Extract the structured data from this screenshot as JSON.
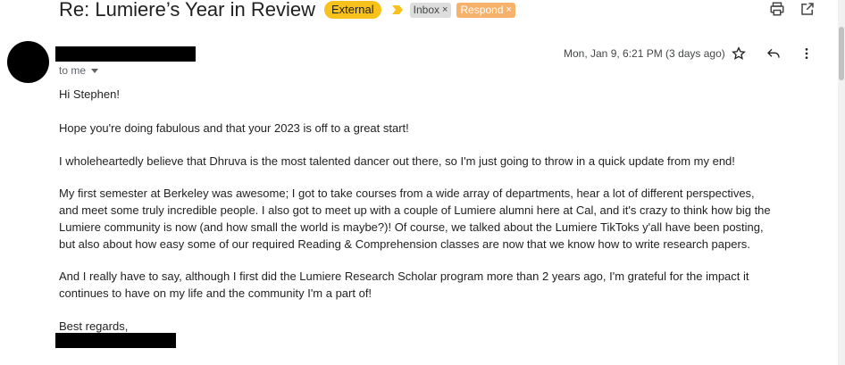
{
  "header": {
    "subject": "Re: Lumiere’s Year in Review",
    "labels": {
      "external": "External",
      "inbox": "Inbox",
      "respond": "Respond",
      "remove_glyph": "×"
    },
    "icons": [
      "print-icon",
      "open-in-new-window-icon"
    ]
  },
  "message": {
    "recipient_line": "to me",
    "date": "Mon, Jan 9, 6:21 PM (3 days ago)",
    "action_icons": [
      "star-icon",
      "reply-icon",
      "more-vert-icon"
    ],
    "body": [
      "Hi Stephen!",
      "Hope you're doing fabulous and that your 2023 is off to a great start!",
      "I wholeheartedly believe that Dhruva is the most talented dancer out there, so I'm just going to throw in a quick update from my end!",
      "My first semester at Berkeley was awesome; I got to take courses from a wide array of departments, hear a lot of different perspectives, and meet some truly incredible people. I also got to meet up with a couple of Lumiere alumni here at Cal, and it's crazy to think how big the Lumiere community is now (and how small the world is maybe?)! Of course, we talked about the Lumiere TikToks y'all have been posting, but also about how easy some of our required Reading & Comprehension classes are now that we know how to write research papers.",
      "And I really have to say, although I first did the Lumiere Research Scholar program more than 2 years ago, I'm grateful for the impact it continues to have on my life and the community I'm a part of!",
      "Best regards,"
    ]
  },
  "colors": {
    "external_label": "#f8c21d",
    "inbox_label": "#dddddd",
    "respond_label": "#f6b26b",
    "important_marker": "#f8c21d",
    "redaction": "#000000"
  }
}
